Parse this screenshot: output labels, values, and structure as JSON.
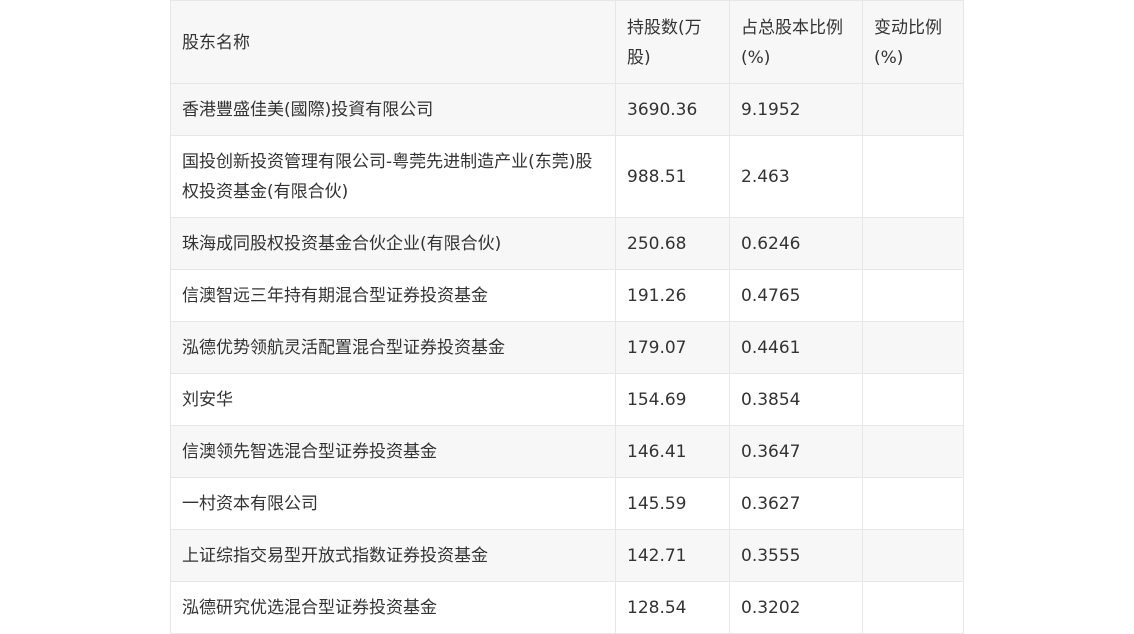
{
  "table": {
    "headers": [
      "股东名称",
      "持股数(万股)",
      "占总股本比例(%)",
      "变动比例(%)"
    ],
    "rows": [
      {
        "name": "香港豐盛佳美(國際)投資有限公司",
        "shares": "3690.36",
        "pct": "9.1952",
        "change": ""
      },
      {
        "name": "国投创新投资管理有限公司-粤莞先进制造产业(东莞)股权投资基金(有限合伙)",
        "shares": "988.51",
        "pct": "2.463",
        "change": ""
      },
      {
        "name": "珠海成同股权投资基金合伙企业(有限合伙)",
        "shares": "250.68",
        "pct": "0.6246",
        "change": ""
      },
      {
        "name": "信澳智远三年持有期混合型证券投资基金",
        "shares": "191.26",
        "pct": "0.4765",
        "change": ""
      },
      {
        "name": "泓德优势领航灵活配置混合型证券投资基金",
        "shares": "179.07",
        "pct": "0.4461",
        "change": ""
      },
      {
        "name": "刘安华",
        "shares": "154.69",
        "pct": "0.3854",
        "change": ""
      },
      {
        "name": "信澳领先智选混合型证券投资基金",
        "shares": "146.41",
        "pct": "0.3647",
        "change": ""
      },
      {
        "name": "一村资本有限公司",
        "shares": "145.59",
        "pct": "0.3627",
        "change": ""
      },
      {
        "name": "上证综指交易型开放式指数证券投资基金",
        "shares": "142.71",
        "pct": "0.3555",
        "change": ""
      },
      {
        "name": "泓德研究优选混合型证券投资基金",
        "shares": "128.54",
        "pct": "0.3202",
        "change": ""
      }
    ]
  }
}
